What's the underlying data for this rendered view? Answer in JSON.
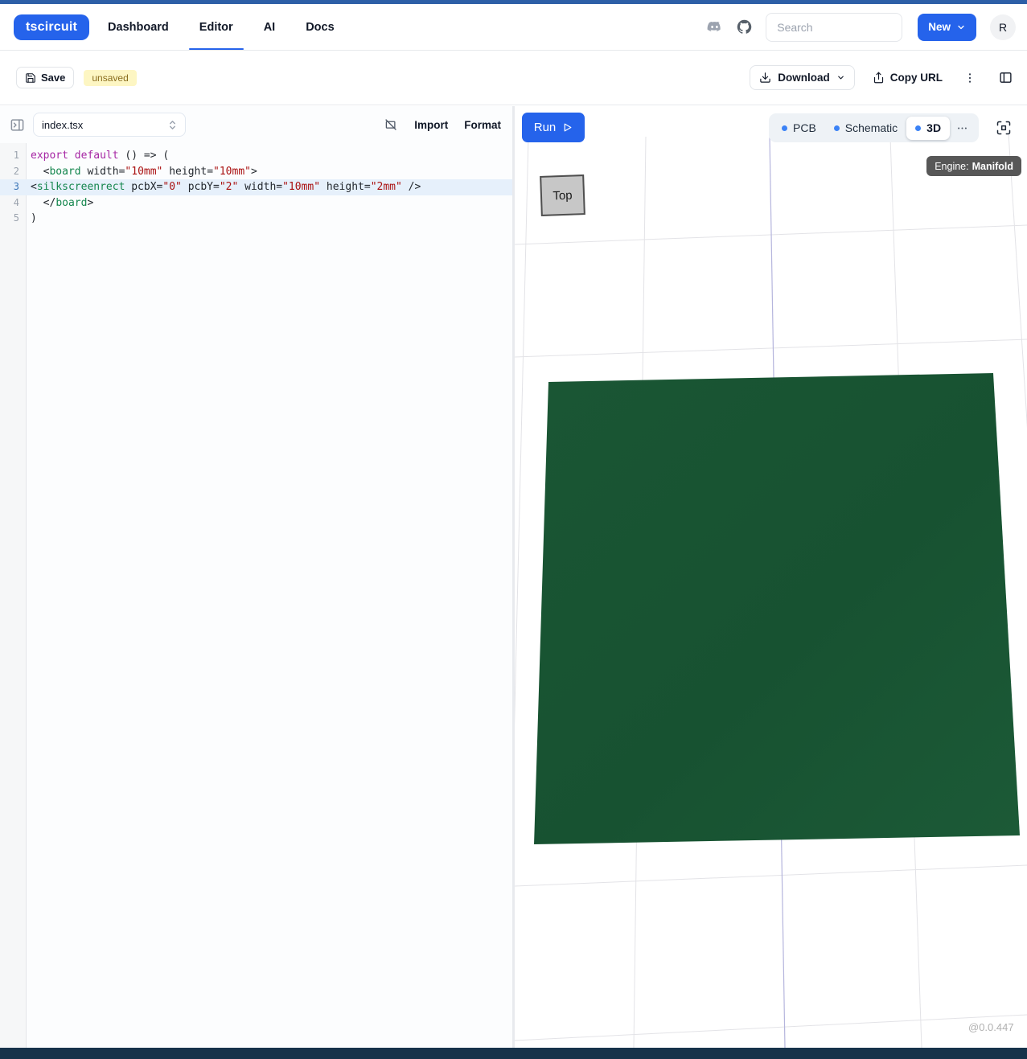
{
  "navbar": {
    "logo": "tscircuit",
    "items": [
      {
        "label": "Dashboard",
        "active": false
      },
      {
        "label": "Editor",
        "active": true
      },
      {
        "label": "AI",
        "active": false
      },
      {
        "label": "Docs",
        "active": false
      }
    ],
    "search_placeholder": "Search",
    "new_label": "New",
    "avatar_initial": "R"
  },
  "toolbar": {
    "save_label": "Save",
    "status_badge": "unsaved",
    "download_label": "Download",
    "copy_url_label": "Copy URL"
  },
  "editor": {
    "file_name": "index.tsx",
    "import_label": "Import",
    "format_label": "Format",
    "active_line": 3,
    "lines": [
      [
        {
          "c": "kw",
          "t": "export"
        },
        {
          "t": " "
        },
        {
          "c": "kw",
          "t": "default"
        },
        {
          "t": " () => ("
        }
      ],
      [
        {
          "t": "  <"
        },
        {
          "c": "tag",
          "t": "board"
        },
        {
          "t": " "
        },
        {
          "c": "attr",
          "t": "width"
        },
        {
          "t": "="
        },
        {
          "c": "str",
          "t": "\"10mm\""
        },
        {
          "t": " "
        },
        {
          "c": "attr",
          "t": "height"
        },
        {
          "t": "="
        },
        {
          "c": "str",
          "t": "\"10mm\""
        },
        {
          "t": ">"
        }
      ],
      [
        {
          "t": "<"
        },
        {
          "c": "tag",
          "t": "silkscreenrect"
        },
        {
          "t": " "
        },
        {
          "c": "attr",
          "t": "pcbX"
        },
        {
          "t": "="
        },
        {
          "c": "str",
          "t": "\"0\""
        },
        {
          "t": " "
        },
        {
          "c": "attr",
          "t": "pcbY"
        },
        {
          "t": "="
        },
        {
          "c": "str",
          "t": "\"2\""
        },
        {
          "t": " "
        },
        {
          "c": "attr",
          "t": "width"
        },
        {
          "t": "="
        },
        {
          "c": "str",
          "t": "\"10mm\""
        },
        {
          "t": " "
        },
        {
          "c": "attr",
          "t": "height"
        },
        {
          "t": "="
        },
        {
          "c": "str",
          "t": "\"2mm\""
        },
        {
          "t": " />"
        }
      ],
      [
        {
          "t": "  </"
        },
        {
          "c": "tag",
          "t": "board"
        },
        {
          "t": ">"
        }
      ],
      [
        {
          "t": ")"
        }
      ]
    ]
  },
  "viewer": {
    "run_label": "Run",
    "tabs": [
      {
        "label": "PCB",
        "active": false
      },
      {
        "label": "Schematic",
        "active": false
      },
      {
        "label": "3D",
        "active": true
      }
    ],
    "engine_label": "Engine:",
    "engine_value": "Manifold",
    "view_cube_label": "Top",
    "version": "@0.0.447"
  },
  "colors": {
    "accent": "#2563eb",
    "top_strip": "#2d5fa7",
    "bottom_bar": "#16324a",
    "board_green": "#185434",
    "badge_bg": "#fdf6c3",
    "badge_text": "#8a6d1f",
    "tooltip_bg": "#575757",
    "tab_dot": "#3b82f6",
    "active_line_bg": "#e6f0fb"
  },
  "icons": {
    "discord-icon": "discord mascot glyph",
    "github-icon": "github octocat glyph",
    "save-icon": "floppy disk",
    "download-icon": "arrow into tray",
    "share-icon": "box with up arrow",
    "kebab-menu-icon": "three vertical dots",
    "panel-right-icon": "square with left divider",
    "panel-toggle-icon": "square, right bar, right chevron",
    "file-select-chevrons-icon": "stacked up/down chevrons",
    "format-off-icon": "slashed rectangle",
    "play-icon": "outlined triangle",
    "chevron-down-icon": "v chevron",
    "more-options-icon": "three horizontal dots",
    "fullscreen-icon": "corner brackets with center square"
  }
}
